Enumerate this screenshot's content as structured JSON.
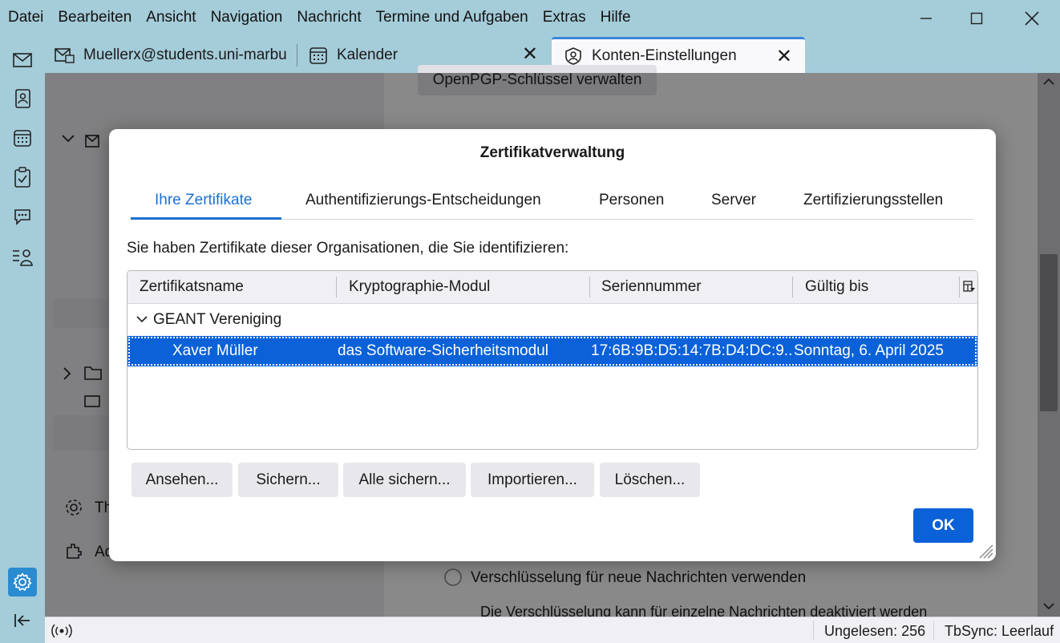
{
  "menu": {
    "items": [
      "Datei",
      "Bearbeiten",
      "Ansicht",
      "Navigation",
      "Nachricht",
      "Termine und Aufgaben",
      "Extras",
      "Hilfe"
    ]
  },
  "tabs": [
    {
      "label": "Muellerx@students.uni-marburg",
      "icon": "mail-account-icon"
    },
    {
      "label": "Kalender",
      "icon": "calendar-icon"
    },
    {
      "label": "Konten-Einstellungen",
      "icon": "account-settings-icon",
      "active": true
    }
  ],
  "background": {
    "openpgp_button": "OpenPGP-Schlüssel verwalten",
    "encryption_option": "Verschlüsselung für neue Nachrichten verwenden",
    "encryption_note": "Die Verschlüsselung kann für einzelne Nachrichten deaktiviert werden",
    "left_item_1": "Th",
    "left_item_2": "Ad"
  },
  "dialog": {
    "title": "Zertifikatverwaltung",
    "tabs": [
      "Ihre Zertifikate",
      "Authentifizierungs-Entscheidungen",
      "Personen",
      "Server",
      "Zertifizierungsstellen"
    ],
    "selected_tab": "Ihre Zertifikate",
    "intro": "Sie haben Zertifikate dieser Organisationen, die Sie identifizieren:",
    "columns": [
      "Zertifikatsname",
      "Kryptographie-Modul",
      "Seriennummer",
      "Gültig bis"
    ],
    "group": "GEANT Vereniging",
    "row": {
      "name": "Xaver Müller",
      "module": "das Software-Sicherheitsmodul",
      "serial": "17:6B:9B:D5:14:7B:D4:DC:9...",
      "valid_until": "Sonntag, 6. April 2025"
    },
    "buttons": {
      "view": "Ansehen...",
      "backup": "Sichern...",
      "backup_all": "Alle sichern...",
      "import": "Importieren...",
      "delete": "Löschen..."
    },
    "ok": "OK"
  },
  "status": {
    "unread": "Ungelesen: 256",
    "tbsync": "TbSync: Leerlauf"
  },
  "colors": {
    "accent": "#0a61d8",
    "chrome": "#a5ccd9"
  }
}
